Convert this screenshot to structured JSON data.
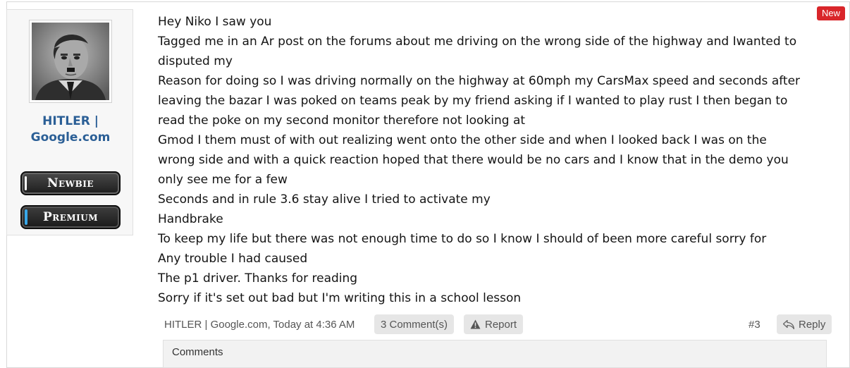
{
  "post": {
    "new_label": "New",
    "author_line1": "HITLER |",
    "author_line2": "Google.com",
    "badges": [
      "Newbie",
      "Premium"
    ],
    "message_lines": [
      "Hey Niko I saw you",
      "Tagged me in an Ar post on the forums about me driving on the wrong side of the highway and Iwanted to",
      "disputed my",
      "Reason for doing so I was driving normally on the highway at 60mph my CarsMax speed and seconds after",
      "leaving the bazar I was poked on teams peak by my friend asking if I wanted to play rust I then began to",
      "read the poke on my second monitor therefore not looking at",
      "Gmod I them must of with out realizing went onto the other side and when I looked back I was on the",
      "wrong side and with a quick reaction hoped that there would be no cars and I know that in the demo you",
      "only see me for a few",
      "Seconds and in rule 3.6 stay alive I tried to activate my",
      "Handbrake",
      "To keep my life but there was not enough time to do so I know I should of been more careful sorry for",
      "Any trouble I had caused",
      "The p1 driver. Thanks for reading",
      "Sorry if it's set out bad but I'm writing this in a school lesson"
    ],
    "meta": "HITLER | Google.com, Today at 4:36 AM",
    "comments_label": "3 Comment(s)",
    "report_label": "Report",
    "post_number": "#3",
    "reply_label": "Reply",
    "comments_header": "Comments",
    "icons": {
      "report": "warning-icon",
      "reply": "reply-icon"
    },
    "colors": {
      "username": "#2b5f96",
      "new_badge": "#d9262a",
      "premium_stripe": "#38a7e8"
    }
  }
}
